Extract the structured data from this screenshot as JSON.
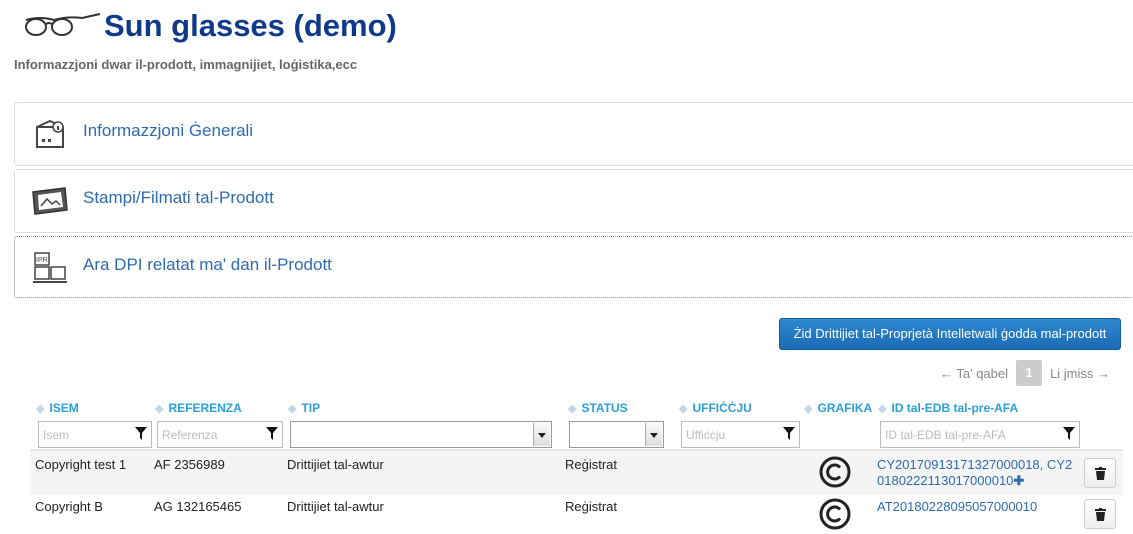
{
  "header": {
    "title": "Sun glasses (demo)",
    "subtitle": "Informazzjoni dwar il-prodott, immagnijiet, loġistika,ecc"
  },
  "panels": [
    {
      "label": "Informazzjoni Ġenerali",
      "icon": "box-info-icon"
    },
    {
      "label": "Stampi/Filmati tal-Prodott",
      "icon": "picture-frame-icon"
    },
    {
      "label": "Ara DPI relatat ma' dan il-Prodott",
      "icon": "ipr-boxes-icon"
    }
  ],
  "add_button": "Żid Drittijiet tal-Proprjetà Intelletwali ġodda mal-prodott",
  "pager": {
    "prev": "← Ta' qabel",
    "page": "1",
    "next": "Li jmiss →"
  },
  "table": {
    "columns": [
      "ISEM",
      "REFERENZA",
      "TIP",
      "STATUS",
      "UFFIĊĊJU",
      "GRAFIKA",
      "ID tal-EDB tal-pre-AFA"
    ],
    "filters": {
      "isem": "Isem",
      "referenza": "Referenza",
      "tip": "",
      "status": "",
      "ufficcju": "Uffiċċju",
      "edb": "ID tal-EDB tal-pre-AFA"
    },
    "rows": [
      {
        "isem": "Copyright test 1",
        "referenza": "AF 2356989",
        "tip": "Drittijiet tal-awtur",
        "status": "Reġistrat",
        "ufficcju": "",
        "grafika": "copyright-icon",
        "edb_line1": "CY20170913171327000018, CY2",
        "edb_line2": "0180222113017000010"
      },
      {
        "isem": "Copyright B",
        "referenza": "AG 132165465",
        "tip": "Drittijiet tal-awtur",
        "status": "Reġistrat",
        "ufficcju": "",
        "grafika": "copyright-icon",
        "edb_line1": "AT20180228095057000010",
        "edb_line2": ""
      }
    ]
  }
}
